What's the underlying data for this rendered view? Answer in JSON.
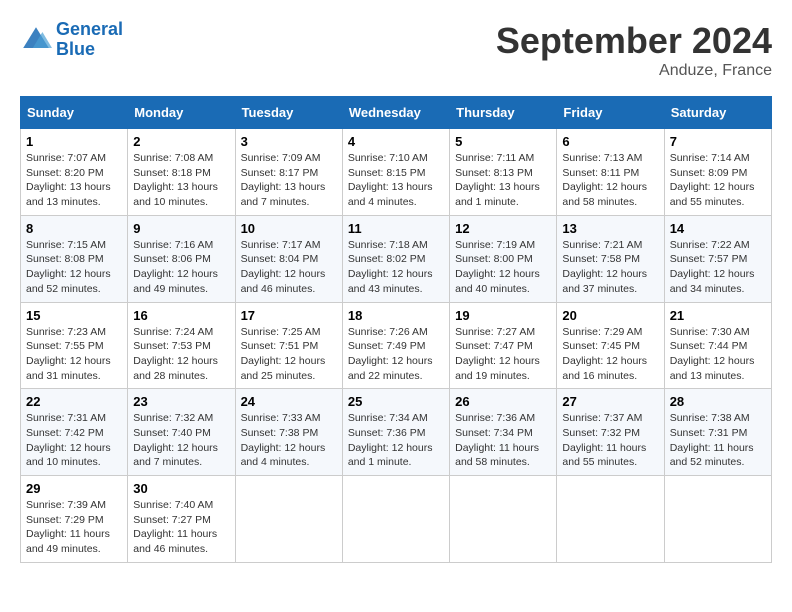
{
  "logo": {
    "line1": "General",
    "line2": "Blue"
  },
  "title": "September 2024",
  "location": "Anduze, France",
  "weekdays": [
    "Sunday",
    "Monday",
    "Tuesday",
    "Wednesday",
    "Thursday",
    "Friday",
    "Saturday"
  ],
  "weeks": [
    [
      {
        "day": "1",
        "info": "Sunrise: 7:07 AM\nSunset: 8:20 PM\nDaylight: 13 hours\nand 13 minutes."
      },
      {
        "day": "2",
        "info": "Sunrise: 7:08 AM\nSunset: 8:18 PM\nDaylight: 13 hours\nand 10 minutes."
      },
      {
        "day": "3",
        "info": "Sunrise: 7:09 AM\nSunset: 8:17 PM\nDaylight: 13 hours\nand 7 minutes."
      },
      {
        "day": "4",
        "info": "Sunrise: 7:10 AM\nSunset: 8:15 PM\nDaylight: 13 hours\nand 4 minutes."
      },
      {
        "day": "5",
        "info": "Sunrise: 7:11 AM\nSunset: 8:13 PM\nDaylight: 13 hours\nand 1 minute."
      },
      {
        "day": "6",
        "info": "Sunrise: 7:13 AM\nSunset: 8:11 PM\nDaylight: 12 hours\nand 58 minutes."
      },
      {
        "day": "7",
        "info": "Sunrise: 7:14 AM\nSunset: 8:09 PM\nDaylight: 12 hours\nand 55 minutes."
      }
    ],
    [
      {
        "day": "8",
        "info": "Sunrise: 7:15 AM\nSunset: 8:08 PM\nDaylight: 12 hours\nand 52 minutes."
      },
      {
        "day": "9",
        "info": "Sunrise: 7:16 AM\nSunset: 8:06 PM\nDaylight: 12 hours\nand 49 minutes."
      },
      {
        "day": "10",
        "info": "Sunrise: 7:17 AM\nSunset: 8:04 PM\nDaylight: 12 hours\nand 46 minutes."
      },
      {
        "day": "11",
        "info": "Sunrise: 7:18 AM\nSunset: 8:02 PM\nDaylight: 12 hours\nand 43 minutes."
      },
      {
        "day": "12",
        "info": "Sunrise: 7:19 AM\nSunset: 8:00 PM\nDaylight: 12 hours\nand 40 minutes."
      },
      {
        "day": "13",
        "info": "Sunrise: 7:21 AM\nSunset: 7:58 PM\nDaylight: 12 hours\nand 37 minutes."
      },
      {
        "day": "14",
        "info": "Sunrise: 7:22 AM\nSunset: 7:57 PM\nDaylight: 12 hours\nand 34 minutes."
      }
    ],
    [
      {
        "day": "15",
        "info": "Sunrise: 7:23 AM\nSunset: 7:55 PM\nDaylight: 12 hours\nand 31 minutes."
      },
      {
        "day": "16",
        "info": "Sunrise: 7:24 AM\nSunset: 7:53 PM\nDaylight: 12 hours\nand 28 minutes."
      },
      {
        "day": "17",
        "info": "Sunrise: 7:25 AM\nSunset: 7:51 PM\nDaylight: 12 hours\nand 25 minutes."
      },
      {
        "day": "18",
        "info": "Sunrise: 7:26 AM\nSunset: 7:49 PM\nDaylight: 12 hours\nand 22 minutes."
      },
      {
        "day": "19",
        "info": "Sunrise: 7:27 AM\nSunset: 7:47 PM\nDaylight: 12 hours\nand 19 minutes."
      },
      {
        "day": "20",
        "info": "Sunrise: 7:29 AM\nSunset: 7:45 PM\nDaylight: 12 hours\nand 16 minutes."
      },
      {
        "day": "21",
        "info": "Sunrise: 7:30 AM\nSunset: 7:44 PM\nDaylight: 12 hours\nand 13 minutes."
      }
    ],
    [
      {
        "day": "22",
        "info": "Sunrise: 7:31 AM\nSunset: 7:42 PM\nDaylight: 12 hours\nand 10 minutes."
      },
      {
        "day": "23",
        "info": "Sunrise: 7:32 AM\nSunset: 7:40 PM\nDaylight: 12 hours\nand 7 minutes."
      },
      {
        "day": "24",
        "info": "Sunrise: 7:33 AM\nSunset: 7:38 PM\nDaylight: 12 hours\nand 4 minutes."
      },
      {
        "day": "25",
        "info": "Sunrise: 7:34 AM\nSunset: 7:36 PM\nDaylight: 12 hours\nand 1 minute."
      },
      {
        "day": "26",
        "info": "Sunrise: 7:36 AM\nSunset: 7:34 PM\nDaylight: 11 hours\nand 58 minutes."
      },
      {
        "day": "27",
        "info": "Sunrise: 7:37 AM\nSunset: 7:32 PM\nDaylight: 11 hours\nand 55 minutes."
      },
      {
        "day": "28",
        "info": "Sunrise: 7:38 AM\nSunset: 7:31 PM\nDaylight: 11 hours\nand 52 minutes."
      }
    ],
    [
      {
        "day": "29",
        "info": "Sunrise: 7:39 AM\nSunset: 7:29 PM\nDaylight: 11 hours\nand 49 minutes."
      },
      {
        "day": "30",
        "info": "Sunrise: 7:40 AM\nSunset: 7:27 PM\nDaylight: 11 hours\nand 46 minutes."
      },
      {
        "day": "",
        "info": ""
      },
      {
        "day": "",
        "info": ""
      },
      {
        "day": "",
        "info": ""
      },
      {
        "day": "",
        "info": ""
      },
      {
        "day": "",
        "info": ""
      }
    ]
  ]
}
